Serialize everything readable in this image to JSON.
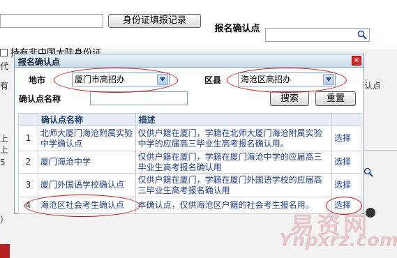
{
  "background": {
    "id_record_button": "身份证填报记录",
    "registration_confirm_label": "报名确认点",
    "non_mainland_id_checkbox_label": "持有非中国大陆身份证",
    "fragments": [
      "代",
      "有",
      "上",
      "上",
      "5",
      "）"
    ],
    "right_fragment": "认点"
  },
  "dialog": {
    "title": "报名确认点",
    "close_glyph": "✕",
    "filters": {
      "city_label": "地市",
      "city_value": "厦门市高招办",
      "district_label": "区县",
      "district_value": "海沧区高招办",
      "point_name_label": "确认点名称",
      "point_name_value": "",
      "search_button": "搜索",
      "reset_button": "重置"
    },
    "table": {
      "headers": [
        "",
        "确认点名称",
        "描述",
        ""
      ],
      "rows": [
        {
          "no": "1",
          "name": "北师大厦门海沧附属实验中学确认点",
          "desc": "仅供户籍在厦门，学籍在北师大厦门海沧附属实验中学的应届高三毕业生高考报名确认用。",
          "action": "选择"
        },
        {
          "no": "2",
          "name": "厦门海沧中学",
          "desc": "仅供户籍在厦门，学籍在厦门海沧中学的应届高三毕业生高考报名确认用",
          "action": "选择"
        },
        {
          "no": "3",
          "name": "厦门外国语学校确认点",
          "desc": "仅供户籍在厦门，学籍在厦门外国语学校的应届高三毕业生高考报名确认用",
          "action": "选择"
        },
        {
          "no": "4",
          "name": "海沧区社会考生确认点",
          "desc": "本确认点，仅供海沧区户籍的社会考生报名用。",
          "action": "选择"
        }
      ]
    }
  },
  "watermark": {
    "line1": "易资网",
    "line2": "Ynpxrz.com"
  },
  "colors": {
    "accent": "#1a40b0",
    "annotation": "#cc1111",
    "close": "#d9231c"
  }
}
